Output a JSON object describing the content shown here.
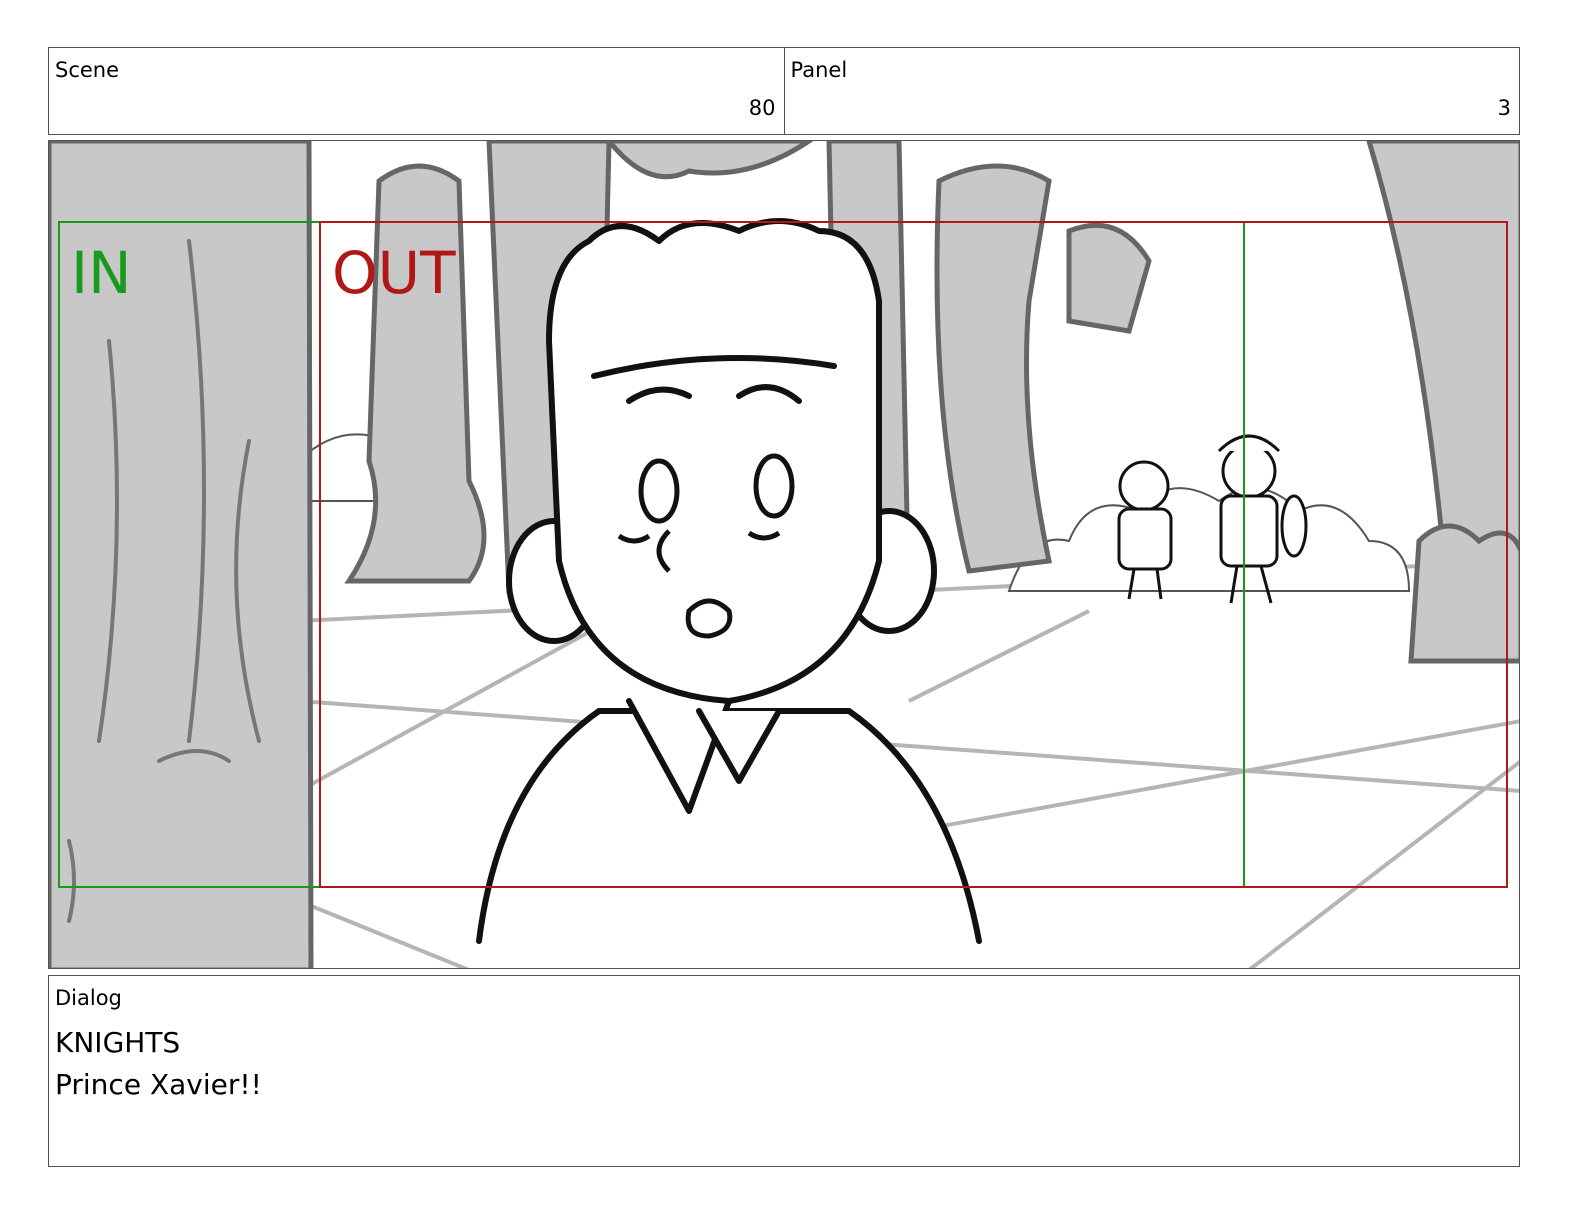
{
  "header": {
    "scene_label": "Scene",
    "scene_value": "80",
    "panel_label": "Panel",
    "panel_value": "3"
  },
  "frame": {
    "in_label": "IN",
    "out_label": "OUT",
    "in_color": "#1a9a1a",
    "out_color": "#b01818"
  },
  "dialog": {
    "label": "Dialog",
    "speaker": "KNIGHTS",
    "line": "Prince Xavier!!"
  }
}
